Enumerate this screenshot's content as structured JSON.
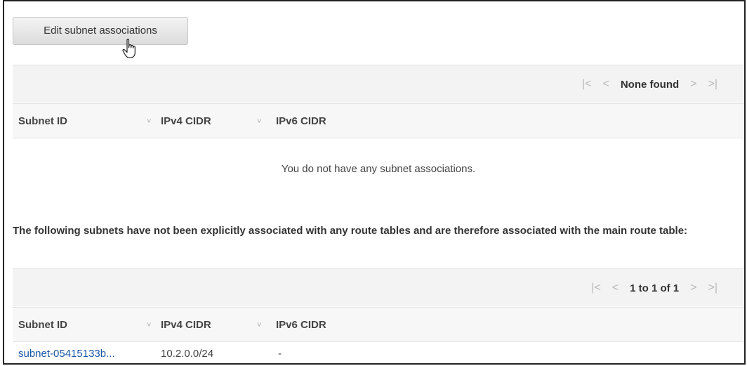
{
  "edit_button_label": "Edit subnet associations",
  "cursor_icon": "hand-pointer-icon",
  "explicit_table": {
    "pager": {
      "first": "|<",
      "prev": "<",
      "text": "None found",
      "next": ">",
      "last": ">|"
    },
    "columns": [
      "Subnet ID",
      "IPv4 CIDR",
      "IPv6 CIDR"
    ],
    "sort_glyph": "˅",
    "empty_message": "You do not have any subnet associations."
  },
  "main_note": "The following subnets have not been explicitly associated with any route tables and are therefore associated with the main route table:",
  "main_table": {
    "pager": {
      "first": "|<",
      "prev": "<",
      "text": "1 to 1 of 1",
      "next": ">",
      "last": ">|"
    },
    "columns": [
      "Subnet ID",
      "IPv4 CIDR",
      "IPv6 CIDR"
    ],
    "sort_glyph": "˅",
    "rows": [
      {
        "subnet_id": "subnet-05415133b...",
        "ipv4": "10.2.0.0/24",
        "ipv6": "-"
      }
    ]
  }
}
